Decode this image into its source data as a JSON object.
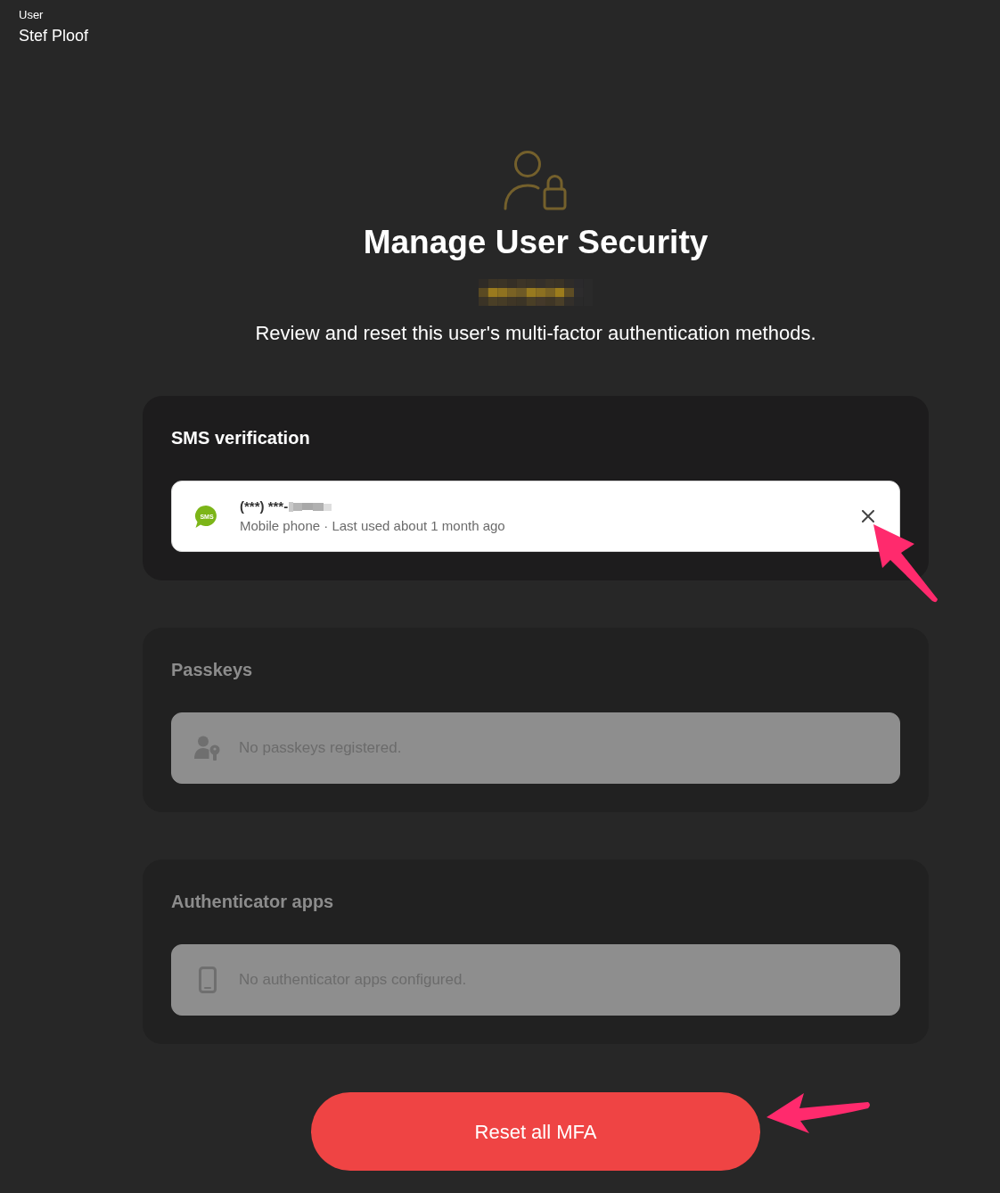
{
  "header": {
    "label": "User",
    "value": "Stef Ploof"
  },
  "page": {
    "title": "Manage User Security",
    "subtitle": "Review and reset this user's multi-factor authentication methods."
  },
  "sections": [
    {
      "kind": "sms",
      "title": "SMS verification",
      "disabled": false,
      "methods": [
        {
          "icon_label": "SMS",
          "number": "(***) ***-",
          "detail": "Mobile phone · Last used about 1 month ago"
        }
      ]
    },
    {
      "kind": "passkeys",
      "title": "Passkeys",
      "disabled": true,
      "empty_message": "No passkeys registered."
    },
    {
      "kind": "authenticator",
      "title": "Authenticator apps",
      "disabled": true,
      "empty_message": "No authenticator apps configured."
    }
  ],
  "reset_button": {
    "label": "Reset all MFA"
  }
}
